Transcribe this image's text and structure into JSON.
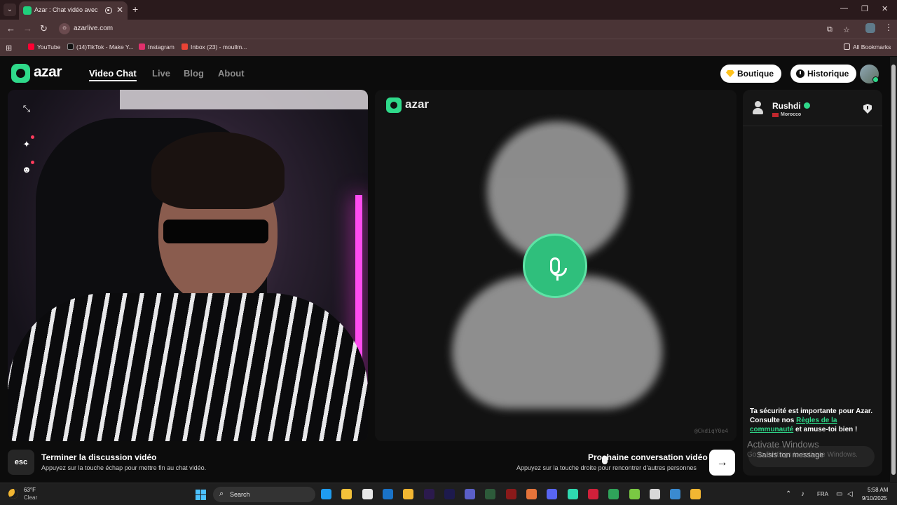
{
  "browser": {
    "tab_title": "Azar : Chat vidéo avec de n",
    "tab_close": "✕",
    "new_tab": "+",
    "url": "azarlive.com",
    "bookmarks": [
      {
        "label": "YouTube",
        "color": "#ff0033"
      },
      {
        "label": "(14)TikTok - Make Y...",
        "color": "#111111"
      },
      {
        "label": "Instagram",
        "color": "#e1306c"
      },
      {
        "label": "Inbox (23) - moullm...",
        "color": "#ea4335"
      }
    ],
    "all_bookmarks": "All Bookmarks"
  },
  "header": {
    "logo": "azar",
    "nav": [
      "Video Chat",
      "Live",
      "Blog",
      "About"
    ],
    "boutique": "Boutique",
    "historique": "Historique"
  },
  "stage": {
    "logo": "azar",
    "session_id": "@CkdiqY0e4"
  },
  "chat": {
    "partner_name": "Rushdi",
    "partner_country": "Morocco",
    "safety_prefix": "Ta sécurité est importante pour Azar. Consulte nos ",
    "safety_link": "Règles de la communauté",
    "safety_suffix": " et amuse-toi bien !",
    "input_placeholder": "Saisis ton message"
  },
  "controls": {
    "esc_key": "esc",
    "end_title": "Terminer la discussion vidéo",
    "end_hint": "Appuyez sur la touche échap pour mettre fin au chat vidéo.",
    "next_title": "Prochaine conversation vidéo",
    "next_hint": "Appuyez sur la touche droite pour rencontrer d'autres personnes",
    "next_arrow": "→"
  },
  "watermark": {
    "line1": "Activate Windows",
    "line2": "Go to Settings to activate Windows."
  },
  "taskbar": {
    "temperature": "63°F",
    "condition": "Clear",
    "search": "Search",
    "language": "FRA",
    "time": "5:58 AM",
    "date": "9/10/2025",
    "apps": [
      {
        "name": "edge",
        "color": "#1f9cf0"
      },
      {
        "name": "file-explorer",
        "color": "#f3c13a"
      },
      {
        "name": "store",
        "color": "#e8e8e8"
      },
      {
        "name": "outlook",
        "color": "#1a73c8"
      },
      {
        "name": "chrome",
        "color": "#f2b632"
      },
      {
        "name": "premiere",
        "color": "#2b1a4d"
      },
      {
        "name": "after-effects",
        "color": "#1d1a4d"
      },
      {
        "name": "teams",
        "color": "#5b5fc7"
      },
      {
        "name": "app-green",
        "color": "#2d5a3a"
      },
      {
        "name": "app-red",
        "color": "#8a1a1a"
      },
      {
        "name": "app-orange",
        "color": "#e5733a"
      },
      {
        "name": "discord",
        "color": "#5865f2"
      },
      {
        "name": "app-teal",
        "color": "#2fd9b0"
      },
      {
        "name": "app-red-2",
        "color": "#d0203a"
      },
      {
        "name": "chrome-2",
        "color": "#2fa35a"
      },
      {
        "name": "app-lime",
        "color": "#7ac943"
      },
      {
        "name": "app-grey",
        "color": "#d8d8d8"
      },
      {
        "name": "app-blue",
        "color": "#3a8ad0"
      },
      {
        "name": "chrome-active",
        "color": "#f2b632"
      }
    ]
  }
}
